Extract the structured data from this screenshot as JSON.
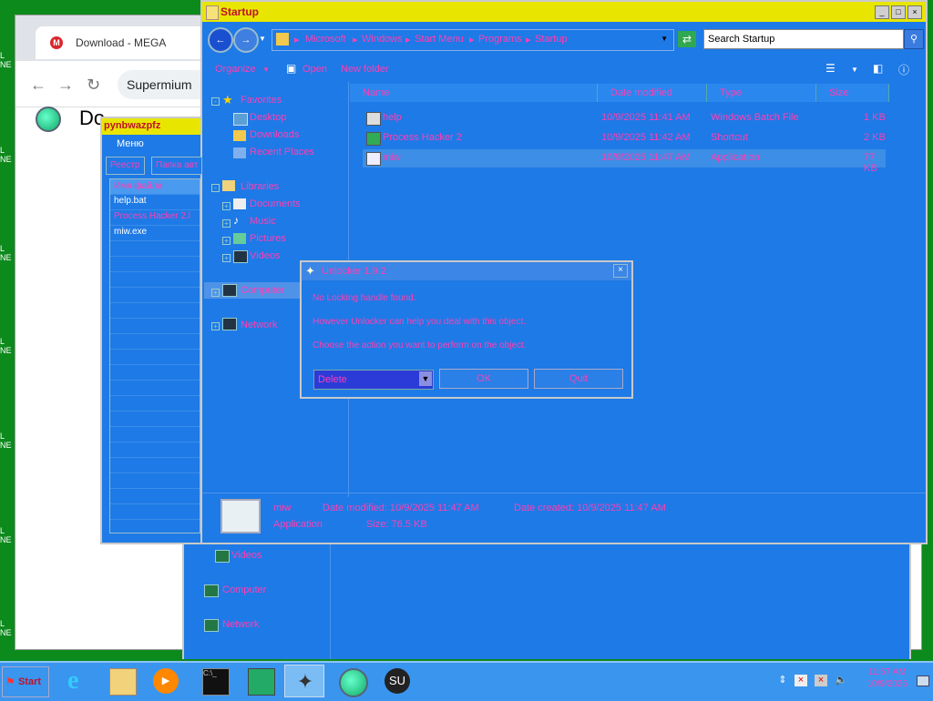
{
  "browser": {
    "tab_title": "Download - MEGA",
    "omnibox_text": "Supermium",
    "page_heading": "Do"
  },
  "explorer": {
    "title": "Startup",
    "breadcrumb": [
      "Microsoft",
      "Windows",
      "Start Menu",
      "Programs",
      "Startup"
    ],
    "search_placeholder": "Search Startup",
    "commands": {
      "organize": "Organize",
      "open": "Open",
      "new_folder": "New folder"
    },
    "nav": {
      "favorites": "Favorites",
      "desktop": "Desktop",
      "downloads": "Downloads",
      "recent": "Recent Places",
      "libraries": "Libraries",
      "documents": "Documents",
      "music": "Music",
      "pictures": "Pictures",
      "videos": "Videos",
      "computer": "Computer",
      "network": "Network"
    },
    "columns": [
      "Name",
      "Date modified",
      "Type",
      "Size"
    ],
    "files": [
      {
        "name": "help",
        "date": "10/9/2025 11:41 AM",
        "type": "Windows Batch File",
        "size": "1 KB"
      },
      {
        "name": "Process Hacker 2",
        "date": "10/9/2025 11:42 AM",
        "type": "Shortcut",
        "size": "2 KB"
      },
      {
        "name": "miw",
        "date": "10/9/2025 11:47 AM",
        "type": "Application",
        "size": "77 KB"
      }
    ],
    "details": {
      "name": "miw",
      "type": "Application",
      "date_modified": "Date modified: 10/9/2025 11:47 AM",
      "size": "Size: 76.5 KB",
      "date_created": "Date created: 10/9/2025 11:47 AM"
    }
  },
  "ruswin": {
    "title": "pynbwazpfz",
    "menu": "Меню",
    "tabs": [
      "Реестр",
      "Папка авт"
    ],
    "list_header": "Имя файла",
    "items": [
      "help.bat",
      "Process Hacker 2.l",
      "miw.exe"
    ]
  },
  "dialog": {
    "title": "Unlocker 1.9.2",
    "line1": "No Locking handle found.",
    "line2": "However Unlocker can help you deal with this object.",
    "line3": "Choose the action you want to perform on the object.",
    "action": "Delete",
    "ok": "OK",
    "quit": "Quit"
  },
  "lower": {
    "videos": "Videos",
    "computer": "Computer",
    "network": "Network"
  },
  "taskbar": {
    "start": "Start",
    "time": "11:57 AM",
    "date": "10/9/2025"
  },
  "desktop_icons": [
    "L NE",
    "L NE",
    "L NE",
    "L NE",
    "L NE",
    "L NE",
    "L NE"
  ],
  "colors": {
    "title_yellow": "#e8e600",
    "title_red": "#c0102a",
    "window_blue": "#1e7ae6",
    "link_pink": "#ff3fb5",
    "desktop_green": "#0d8a1c"
  }
}
